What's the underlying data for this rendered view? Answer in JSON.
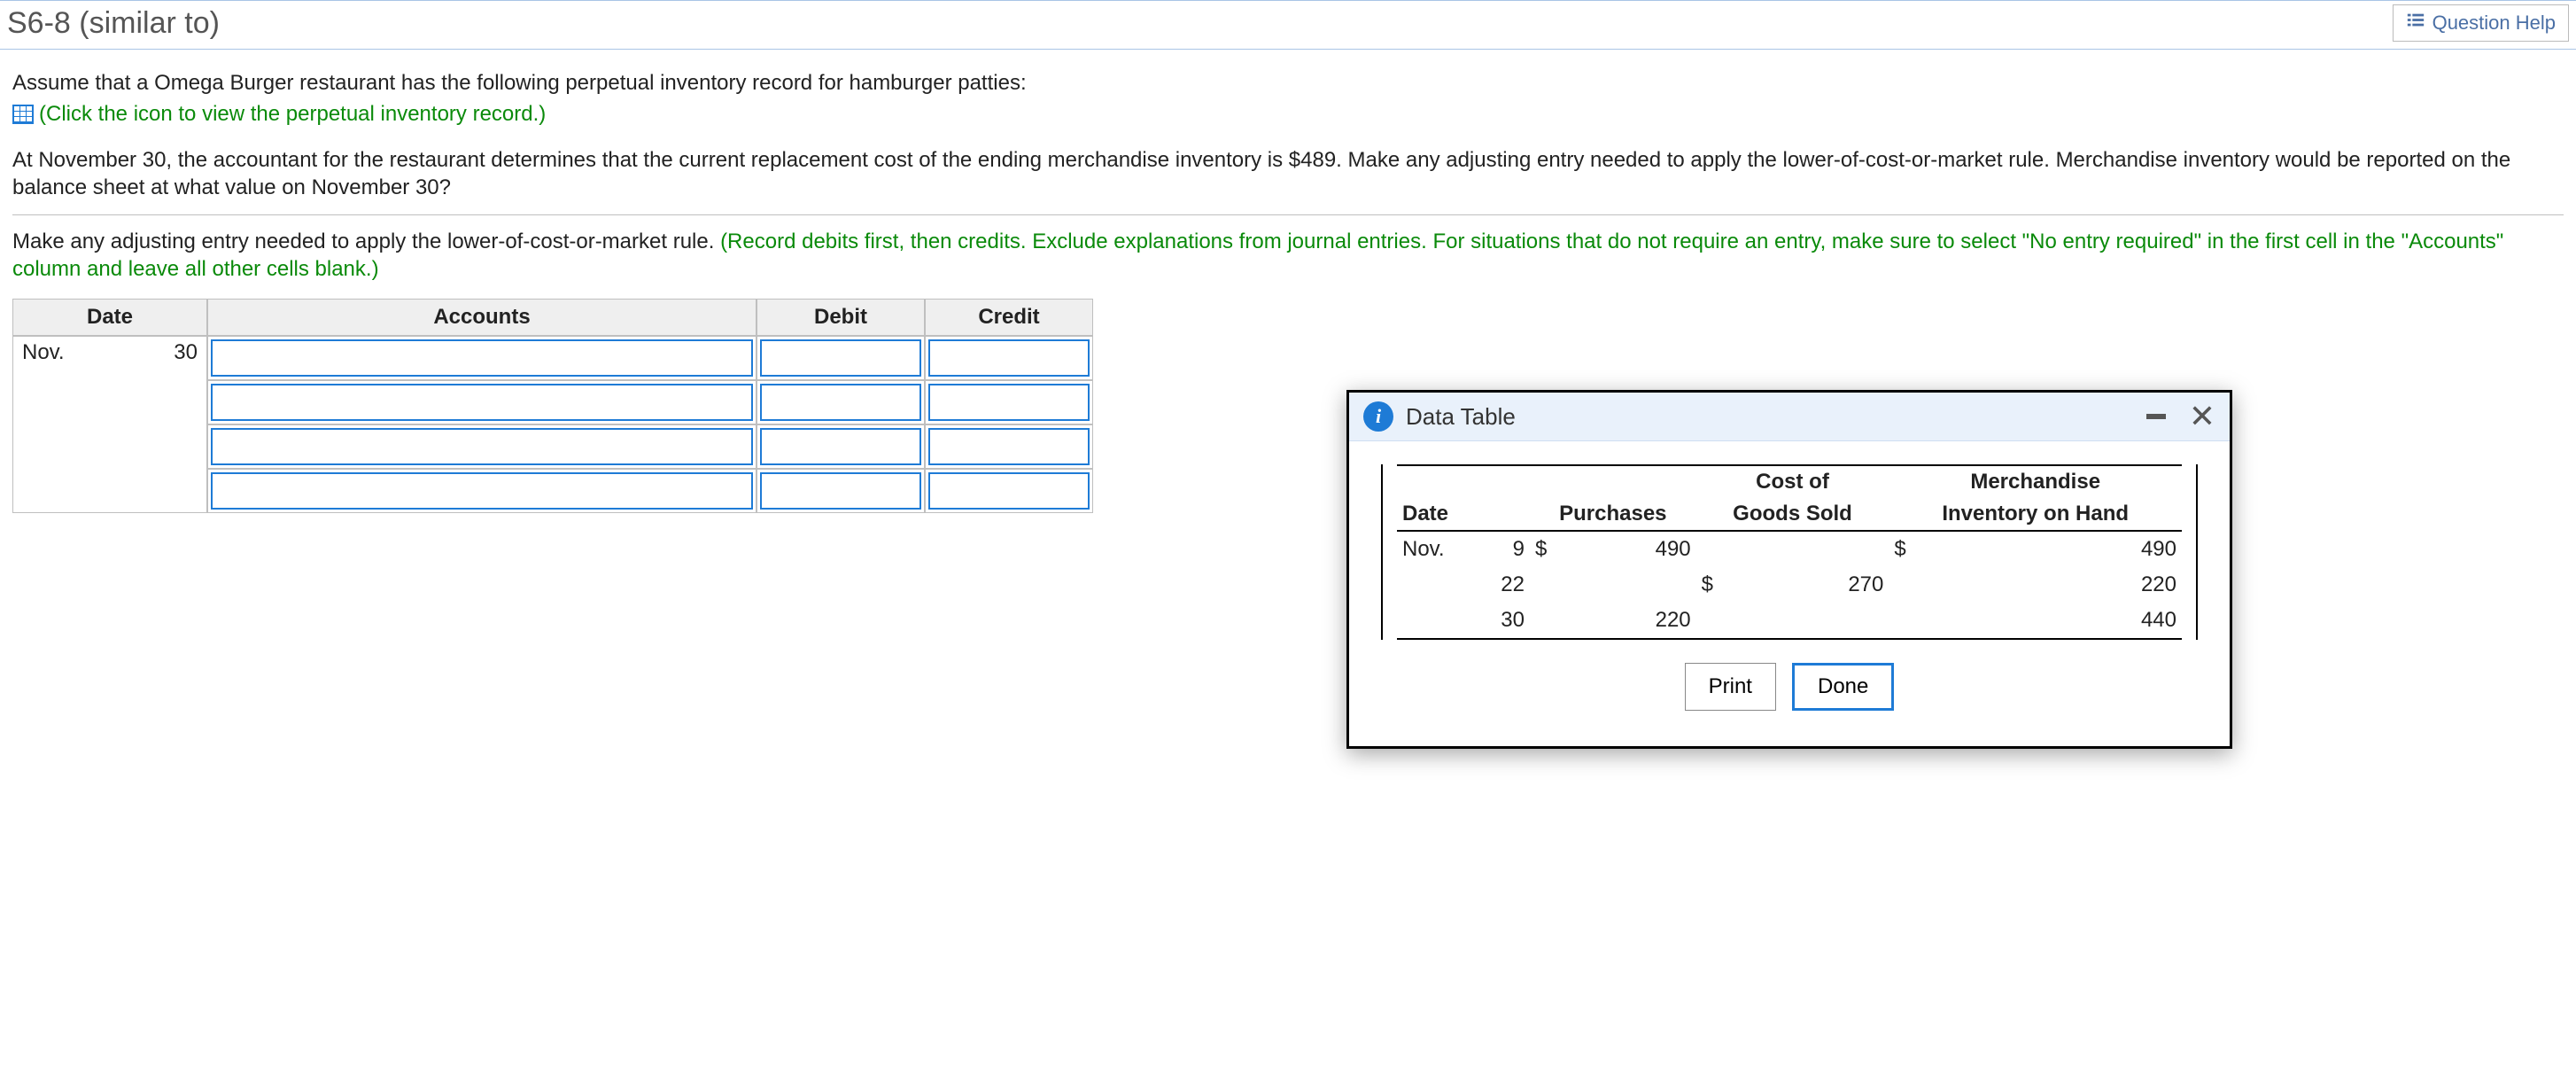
{
  "header": {
    "title": "S6-8 (similar to)",
    "help_label": "Question Help"
  },
  "problem": {
    "intro": "Assume that a Omega Burger restaurant has the following perpetual inventory record for hamburger patties:",
    "click_link": "(Click the icon to view the perpetual inventory record.)",
    "body": "At November 30, the accountant for the restaurant determines that the current replacement cost of the ending merchandise inventory is $489. Make any adjusting entry needed to apply the lower-of-cost-or-market rule. Merchandise inventory would be reported on the balance sheet at what value on November 30?",
    "task_plain": "Make any adjusting entry needed to apply the lower-of-cost-or-market rule. ",
    "task_green": "(Record debits first, then credits. Exclude explanations from journal entries. For situations that do not require an entry, make sure to select \"No entry required\" in the first cell in the \"Accounts\" column and leave all other cells blank.)"
  },
  "journal": {
    "headers": {
      "date": "Date",
      "accounts": "Accounts",
      "debit": "Debit",
      "credit": "Credit"
    },
    "date_month": "Nov.",
    "date_day": "30"
  },
  "modal": {
    "title": "Data Table",
    "print_label": "Print",
    "done_label": "Done",
    "headers": {
      "date": "Date",
      "purchases": "Purchases",
      "cogs_top": "Cost of",
      "cogs_bot": "Goods Sold",
      "inv_top": "Merchandise",
      "inv_bot": "Inventory on Hand"
    },
    "month": "Nov.",
    "rows": [
      {
        "day": "9",
        "p_sym": "$",
        "purchases": "490",
        "c_sym": "",
        "cogs": "",
        "i_sym": "$",
        "inv": "490"
      },
      {
        "day": "22",
        "p_sym": "",
        "purchases": "",
        "c_sym": "$",
        "cogs": "270",
        "i_sym": "",
        "inv": "220"
      },
      {
        "day": "30",
        "p_sym": "",
        "purchases": "220",
        "c_sym": "",
        "cogs": "",
        "i_sym": "",
        "inv": "440"
      }
    ]
  },
  "chart_data": {
    "type": "table",
    "title": "Perpetual Inventory Record",
    "columns": [
      "Date",
      "Purchases",
      "Cost of Goods Sold",
      "Merchandise Inventory on Hand"
    ],
    "rows": [
      {
        "date": "Nov. 9",
        "purchases": 490,
        "cogs": null,
        "inventory": 490
      },
      {
        "date": "Nov. 22",
        "purchases": null,
        "cogs": 270,
        "inventory": 220
      },
      {
        "date": "Nov. 30",
        "purchases": 220,
        "cogs": null,
        "inventory": 440
      }
    ],
    "currency": "$"
  }
}
